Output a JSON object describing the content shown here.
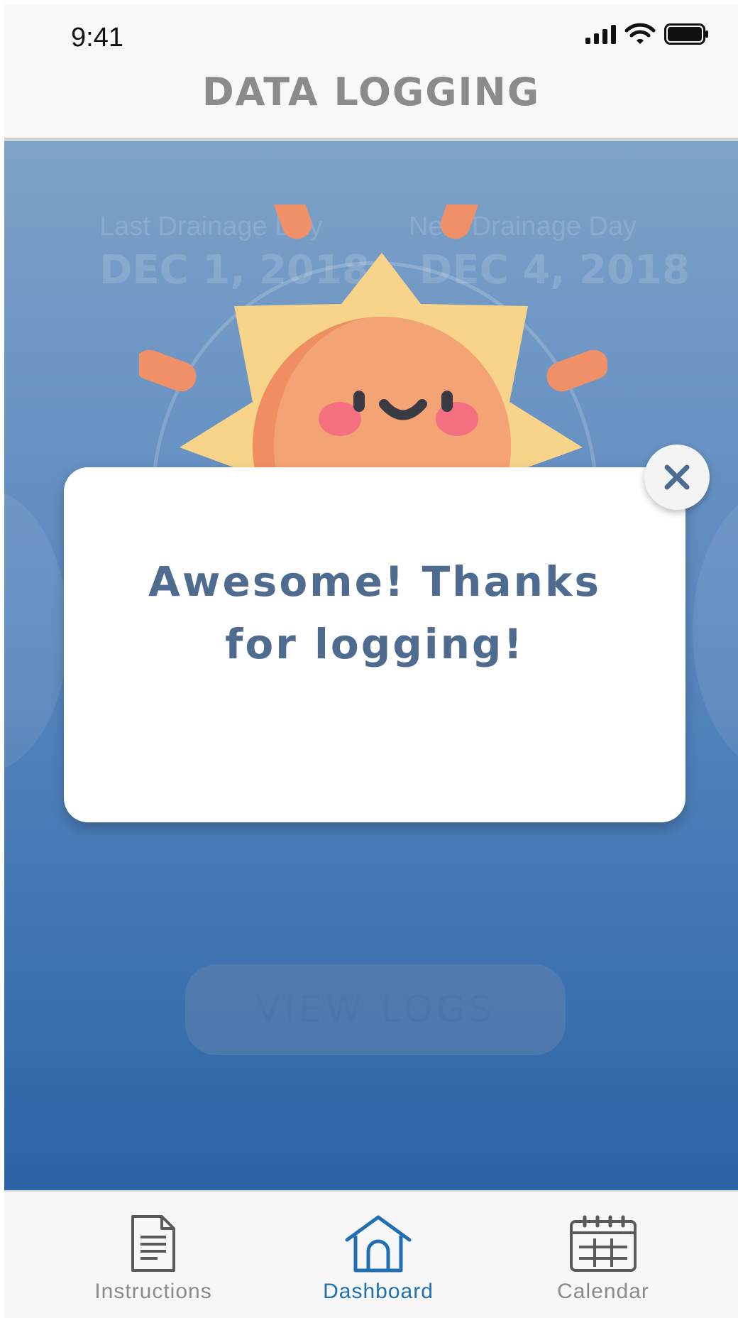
{
  "status_bar": {
    "time": "9:41"
  },
  "header": {
    "title": "DATA LOGGING"
  },
  "dashboard": {
    "last_drainage": {
      "label": "Last Drainage Day",
      "date": "DEC 1, 2018"
    },
    "next_drainage": {
      "label": "Next Drainage Day",
      "date": "DEC 4, 2018"
    },
    "view_logs_label": "VIEW LOGS"
  },
  "modal": {
    "line1": "Awesome! Thanks",
    "line2": "for logging!",
    "close_icon": "close-icon"
  },
  "tab_bar": {
    "tabs": [
      {
        "label": "Instructions",
        "icon": "document-icon",
        "active": false
      },
      {
        "label": "Dashboard",
        "icon": "home-icon",
        "active": true
      },
      {
        "label": "Calendar",
        "icon": "calendar-icon",
        "active": false
      }
    ]
  },
  "colors": {
    "accent": "#1f6fb2",
    "inactive": "#8a8a8a",
    "modal_text": "#4f6b8f",
    "sun_face": "#f29a6b",
    "sun_rays": "#f7d489",
    "gradient_top": "#7ea2c8",
    "gradient_bottom": "#2c63a6"
  }
}
